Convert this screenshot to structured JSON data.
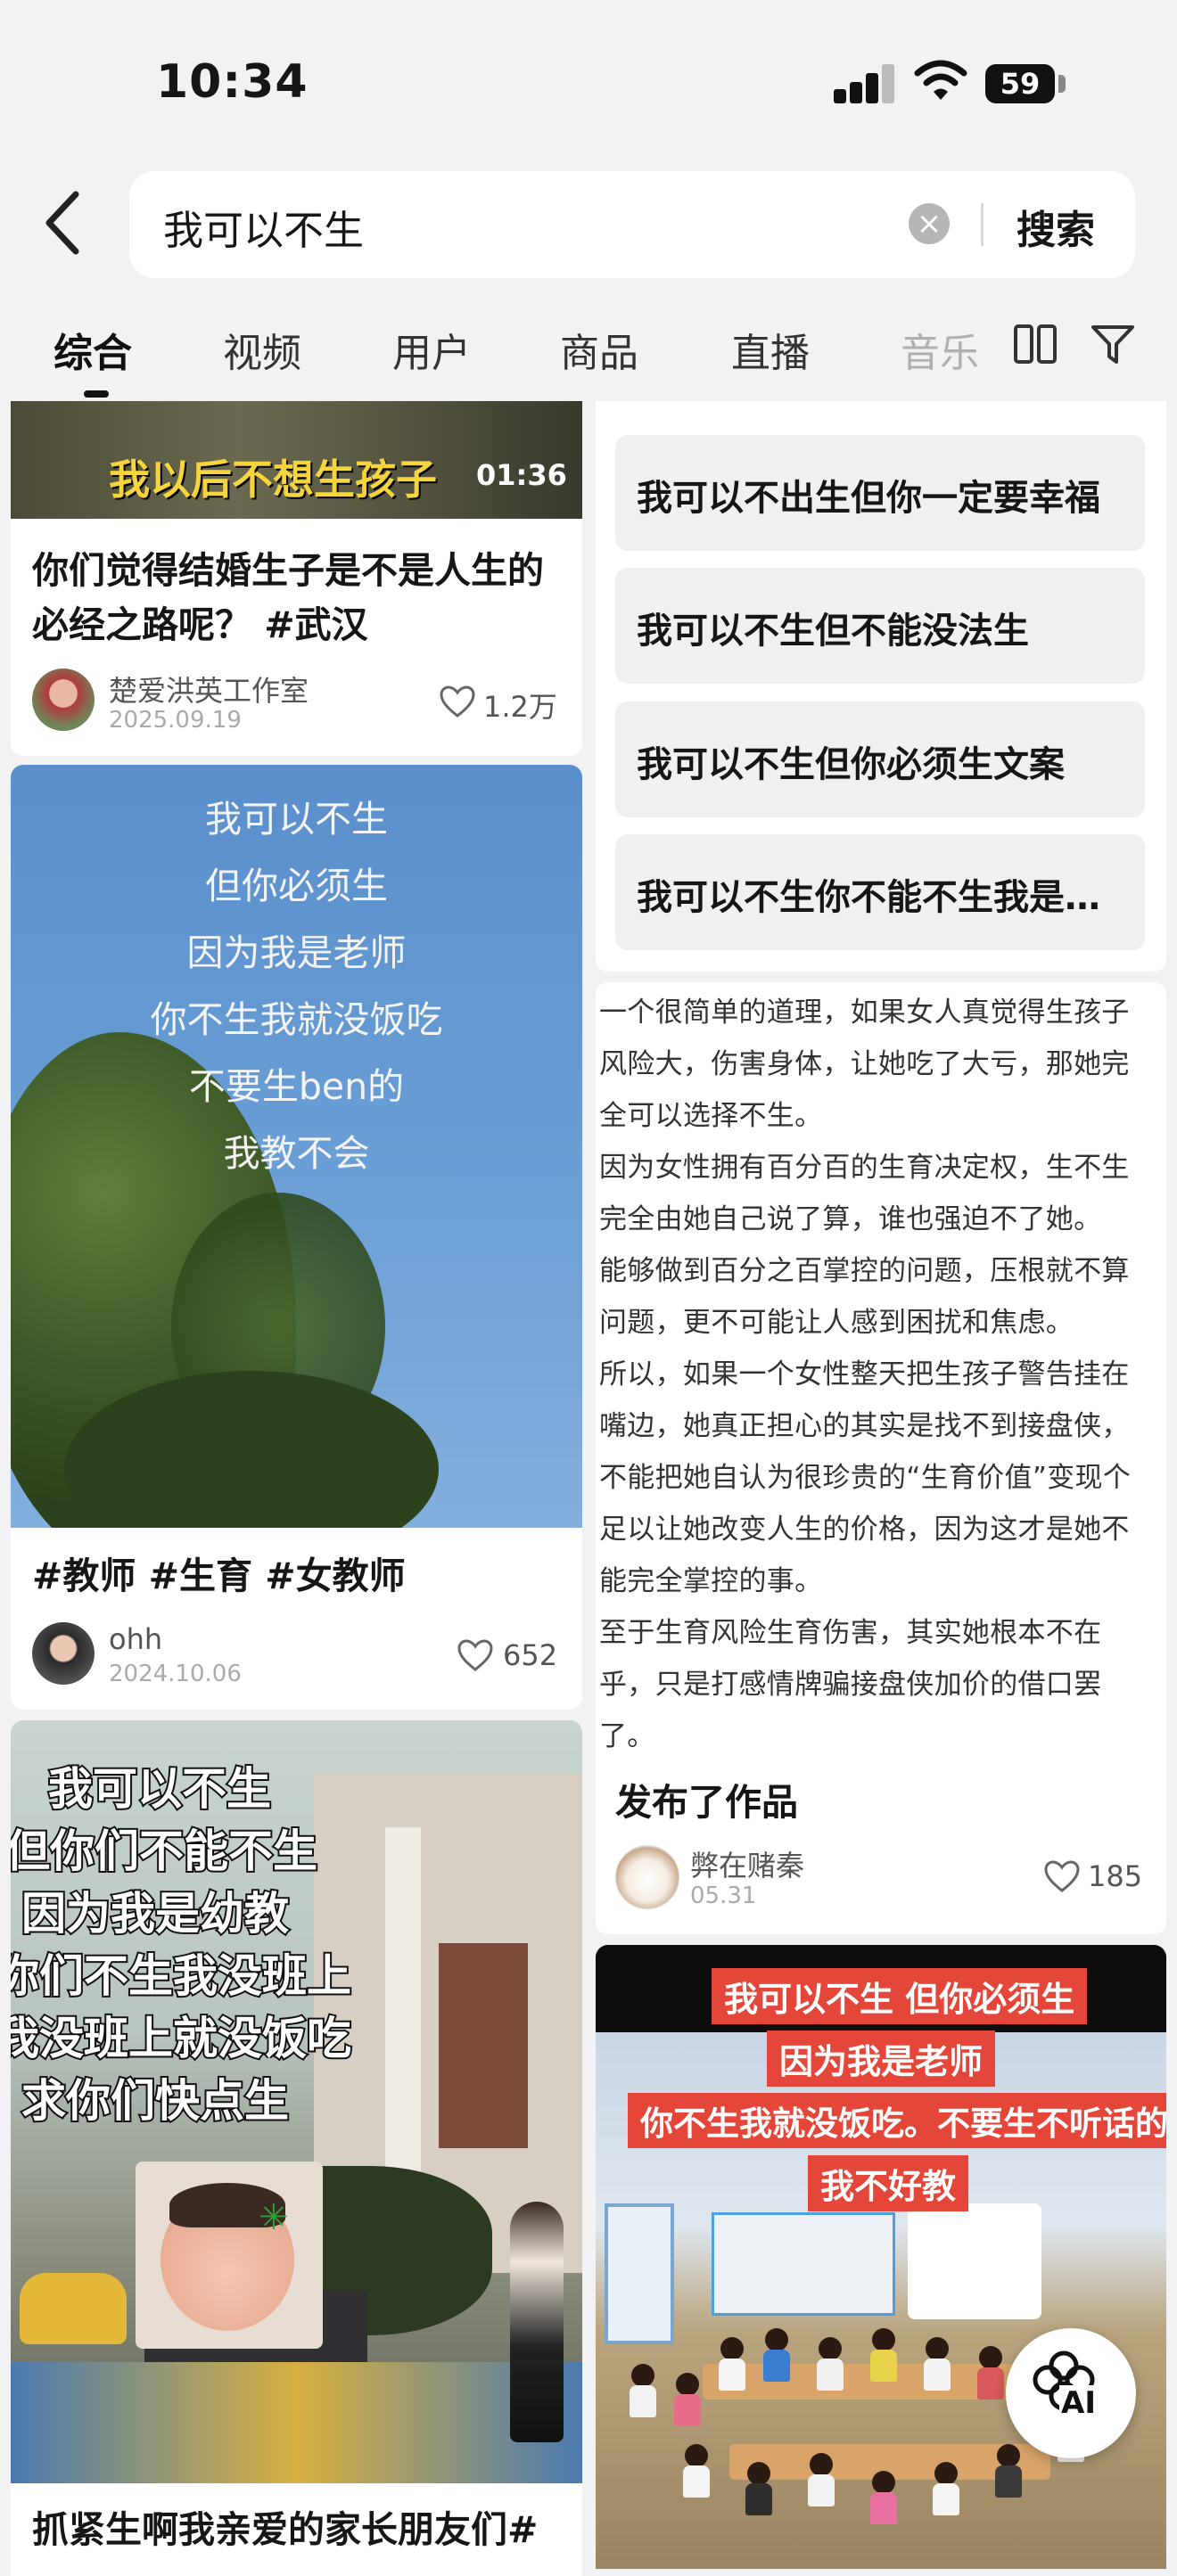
{
  "status_bar": {
    "time": "10:34",
    "battery": "59"
  },
  "search": {
    "query": "我可以不生",
    "submit_label": "搜索"
  },
  "tabs": [
    "综合",
    "视频",
    "用户",
    "商品",
    "直播",
    "音乐"
  ],
  "left_column": {
    "card1": {
      "video_caption": "我以后不想生孩子",
      "duration": "01:36",
      "title_lines": [
        "你们觉得结婚生子是不是人生的",
        "必经之路呢？ #武汉"
      ],
      "author": "楚爱洪英工作室",
      "date": "2025.09.19",
      "likes": "1.2万"
    },
    "card2": {
      "overlay_lines": [
        "我可以不生",
        "但你必须生",
        "因为我是老师",
        "你不生我就没饭吃",
        "不要生ben的",
        "我教不会"
      ],
      "title": "#教师 #生育 #女教师",
      "author": "ohh",
      "date": "2024.10.06",
      "likes": "652"
    },
    "card3": {
      "overlay_lines": [
        "我可以不生",
        "但你们不能不生",
        "因为我是幼教",
        "你们不生我没班上",
        "我没班上就没饭吃",
        "求你们快点生"
      ],
      "title": "抓紧生啊我亲爱的家长朋友们#"
    }
  },
  "right_column": {
    "suggestions": [
      "我可以不出生但你一定要幸福",
      "我可以不生但不能没法生",
      "我可以不生但你必须生文案",
      "我可以不生你不能不生我是…"
    ],
    "article_lines": [
      "一个很简单的道理，如果女人真觉得生孩子",
      "风险大，伤害身体，让她吃了大亏，那她完",
      "全可以选择不生。",
      "因为女性拥有百分百的生育决定权，生不生",
      "完全由她自己说了算，谁也强迫不了她。",
      "能够做到百分之百掌控的问题，压根就不算",
      "问题，更不可能让人感到困扰和焦虑。",
      "所以，如果一个女性整天把生孩子警告挂在",
      "嘴边，她真正担心的其实是找不到接盘侠，",
      "不能把她自认为很珍贵的“生育价值”变现个",
      "足以让她改变人生的价格，因为这才是她不",
      "能完全掌控的事。",
      "至于生育风险生育伤害，其实她根本不在",
      "乎，只是打感情牌骗接盘侠加价的借口罢",
      "了。"
    ],
    "article_title": "发布了作品",
    "article_author": "弊在赌秦",
    "article_date": "05.31",
    "article_likes": "185",
    "card4_overlay": [
      "我可以不生  但你必须生",
      "因为我是老师",
      "你不生我就没饭吃。不要生不听话的，",
      "我不好教"
    ]
  },
  "ai_button": "AI",
  "icons": {
    "back": "back-arrow-icon",
    "clear": "clear-icon",
    "layout": "dual-column-icon",
    "filter": "filter-icon",
    "like": "heart-icon"
  }
}
